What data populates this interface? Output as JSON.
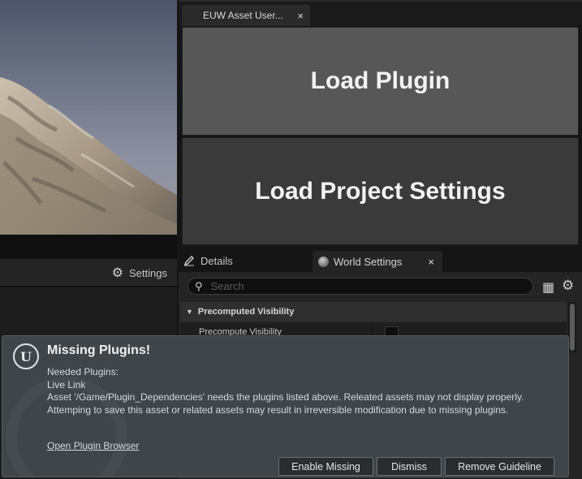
{
  "right_panel": {
    "tab_title": "EUW Asset User...",
    "tab_close": "×",
    "buttons": {
      "load_plugin": "Load Plugin",
      "load_project_settings": "Load Project Settings"
    }
  },
  "left_panel": {
    "settings_label": "Settings",
    "settings_icon": "⚙"
  },
  "details": {
    "tabs": [
      {
        "label": "Details",
        "icon": "pencil-icon"
      },
      {
        "label": "World Settings",
        "icon": "globe-icon",
        "close": "×"
      }
    ],
    "search": {
      "placeholder": "Search",
      "value": ""
    },
    "category": "Precomputed Visibility",
    "properties": [
      {
        "label": "Precompute Visibility",
        "checked": false
      }
    ]
  },
  "notification": {
    "title": "Missing Plugins!",
    "lines": [
      "Needed Plugins:",
      "Live Link",
      "Asset '/Game/Plugin_Dependencies' needs the plugins listed above. Releated assets may not display properly.",
      "Attemping to save this asset or related assets may result in irreversible modification due to missing plugins."
    ],
    "link": "Open Plugin Browser",
    "buttons": {
      "enable": "Enable Missing",
      "dismiss": "Dismiss",
      "remove": "Remove Guideline"
    }
  }
}
